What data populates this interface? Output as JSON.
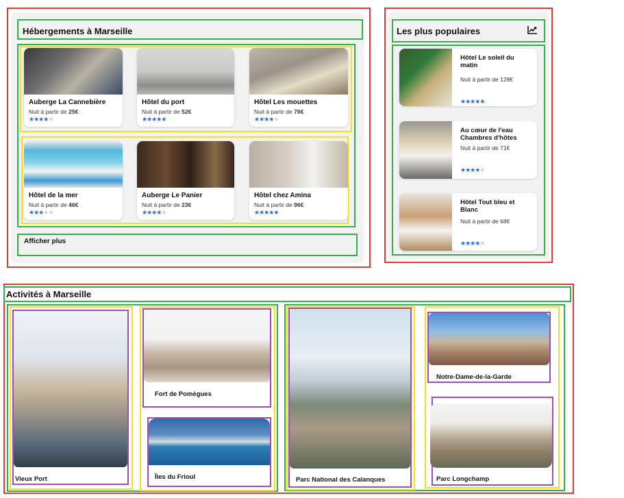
{
  "accommodations": {
    "title": "Hébergements à Marseille",
    "show_more": "Afficher plus",
    "price_prefix": "Nuit à partir de ",
    "hotels": [
      {
        "name": "Auberge La Cannebière",
        "price": "25€",
        "stars": 4
      },
      {
        "name": "Hôtel du port",
        "price": "52€",
        "stars": 5
      },
      {
        "name": "Hôtel Les mouettes",
        "price": "76€",
        "stars": 4
      },
      {
        "name": "Hôtel de la mer",
        "price": "46€",
        "stars": 3
      },
      {
        "name": "Auberge Le Panier",
        "price": "23€",
        "stars": 4
      },
      {
        "name": "Hôtel chez Amina",
        "price": "96€",
        "stars": 5
      }
    ]
  },
  "popular": {
    "title": "Les plus populaires",
    "icon": "trending-chart-icon",
    "items": [
      {
        "name": "Hôtel Le soleil du matin",
        "price": "Nuit à partir de 128€",
        "stars": 5
      },
      {
        "name": "Au cœur de l'eau Chambres d'hôtes",
        "price": "Nuit à partir de 71€",
        "stars": 4
      },
      {
        "name": "Hôtel Tout bleu et Blanc",
        "price": "Nuit à partir de 68€",
        "stars": 4
      }
    ]
  },
  "activities": {
    "title": "Activités à Marseille",
    "items": [
      {
        "name": "Vieux Port"
      },
      {
        "name": "Fort de Pomègues"
      },
      {
        "name": "Îles du Frioul"
      },
      {
        "name": "Parc National des Calanques"
      },
      {
        "name": "Notre-Dame-de-la-Garde"
      },
      {
        "name": "Parc Longchamp"
      }
    ]
  },
  "colors": {
    "star_on": "#1a6fe8",
    "annotation_red": "#e53935",
    "annotation_green": "#2eb24a",
    "annotation_yellow": "#f5e11b",
    "annotation_purple": "#9b4fb0"
  }
}
